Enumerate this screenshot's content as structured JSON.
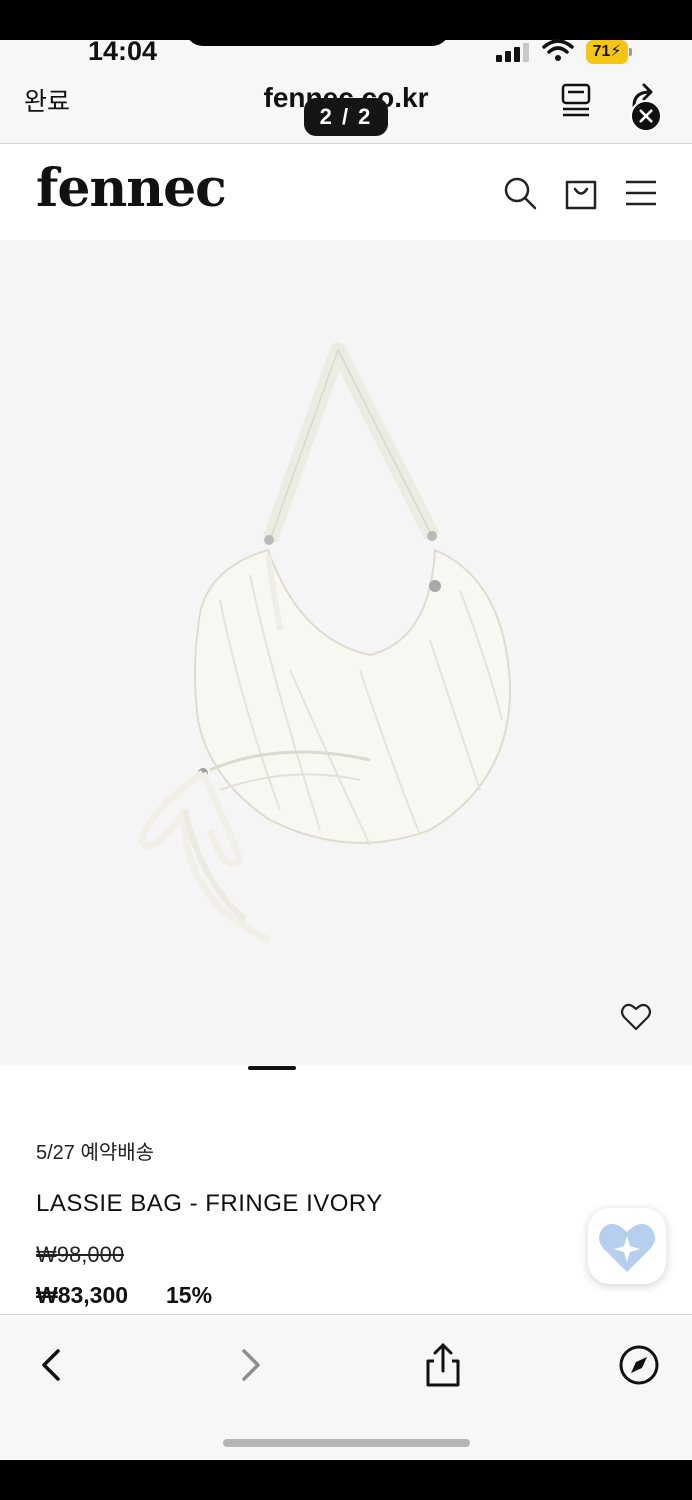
{
  "status_bar": {
    "time": "14:04",
    "battery": "71"
  },
  "browser": {
    "done_label": "완료",
    "url": "fennec.co.kr",
    "page_indicator": "2 / 2"
  },
  "site": {
    "logo": "fennec"
  },
  "product": {
    "delivery_note": "5/27 예약배송",
    "name": "LASSIE BAG - FRINGE IVORY",
    "original_price": "₩98,000",
    "sale_price": "₩83,300",
    "discount": "15%"
  },
  "icons": {
    "header": [
      "search-icon",
      "cart-icon",
      "menu-icon"
    ],
    "browser_top": [
      "reader-icon",
      "reload-icon",
      "close-icon"
    ],
    "browser_bottom": [
      "back-icon",
      "forward-icon",
      "share-icon",
      "compass-icon"
    ],
    "misc": [
      "heart-outline-icon",
      "heart-fab-icon"
    ]
  },
  "colors": {
    "background": "#ffffff",
    "image_background": "#f5f5f5",
    "browser_chrome": "#f7f7f7",
    "battery": "#f5c518",
    "text": "#111111",
    "heart_fab": "#a7c4ea"
  }
}
